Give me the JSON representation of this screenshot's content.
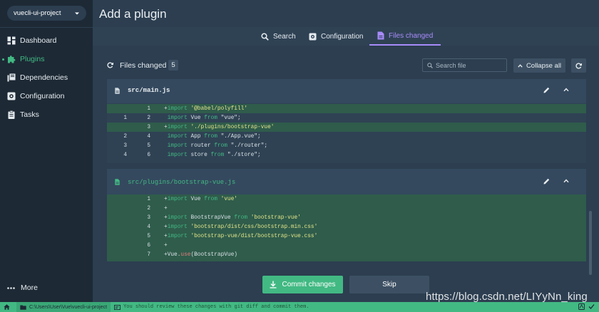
{
  "project": {
    "name": "vuecli-ui-project"
  },
  "nav": {
    "items": [
      {
        "label": "Dashboard",
        "icon": "dashboard-icon",
        "active": false
      },
      {
        "label": "Plugins",
        "icon": "puzzle-icon",
        "active": true
      },
      {
        "label": "Dependencies",
        "icon": "library-icon",
        "active": false
      },
      {
        "label": "Configuration",
        "icon": "gear-icon",
        "active": false
      },
      {
        "label": "Tasks",
        "icon": "clipboard-icon",
        "active": false
      }
    ],
    "more": "More"
  },
  "header": {
    "title": "Add a plugin"
  },
  "tabs": [
    {
      "label": "Search",
      "icon": "search-icon"
    },
    {
      "label": "Configuration",
      "icon": "gear-icon"
    },
    {
      "label": "Files changed",
      "icon": "file-icon",
      "active": true
    }
  ],
  "files": {
    "label": "Files changed",
    "count": "5",
    "search_placeholder": "Search file",
    "collapse_label": "Collapse all"
  },
  "panels": [
    {
      "file": "src/main.js",
      "lines": [
        {
          "old": "",
          "new": "1",
          "added": true,
          "code": "+import '@babel/polyfill'"
        },
        {
          "old": "1",
          "new": "2",
          "added": false,
          "code": " import Vue from \"vue\";"
        },
        {
          "old": "",
          "new": "3",
          "added": true,
          "code": "+import './plugins/bootstrap-vue'"
        },
        {
          "old": "2",
          "new": "4",
          "added": false,
          "code": " import App from \"./App.vue\";"
        },
        {
          "old": "3",
          "new": "5",
          "added": false,
          "code": " import router from \"./router\";"
        },
        {
          "old": "4",
          "new": "6",
          "added": false,
          "code": " import store from \"./store\";"
        }
      ]
    },
    {
      "file": "src/plugins/bootstrap-vue.js",
      "lines": [
        {
          "old": "",
          "new": "1",
          "added": true,
          "code": "+import Vue from 'vue'"
        },
        {
          "old": "",
          "new": "2",
          "added": true,
          "code": "+"
        },
        {
          "old": "",
          "new": "3",
          "added": true,
          "code": "+import BootstrapVue from 'bootstrap-vue'"
        },
        {
          "old": "",
          "new": "4",
          "added": true,
          "code": "+import 'bootstrap/dist/css/bootstrap.min.css'"
        },
        {
          "old": "",
          "new": "5",
          "added": true,
          "code": "+import 'bootstrap-vue/dist/bootstrap-vue.css'"
        },
        {
          "old": "",
          "new": "6",
          "added": true,
          "code": "+"
        },
        {
          "old": "",
          "new": "7",
          "added": true,
          "code": "+Vue.use(BootstrapVue)"
        }
      ]
    }
  ],
  "actions": {
    "commit": "Commit changes",
    "skip": "Skip"
  },
  "watermark": "https://blog.csdn.net/LIYyNn_king",
  "status": {
    "path": "C:\\Users\\User\\Vue\\vuecli-ui-project",
    "message": "You should review these changes with git diff and commit them."
  },
  "colors": {
    "accent": "#42b983",
    "tab_active": "#a78bfa",
    "sidebar": "#1d2935",
    "background": "#2c3e50"
  }
}
